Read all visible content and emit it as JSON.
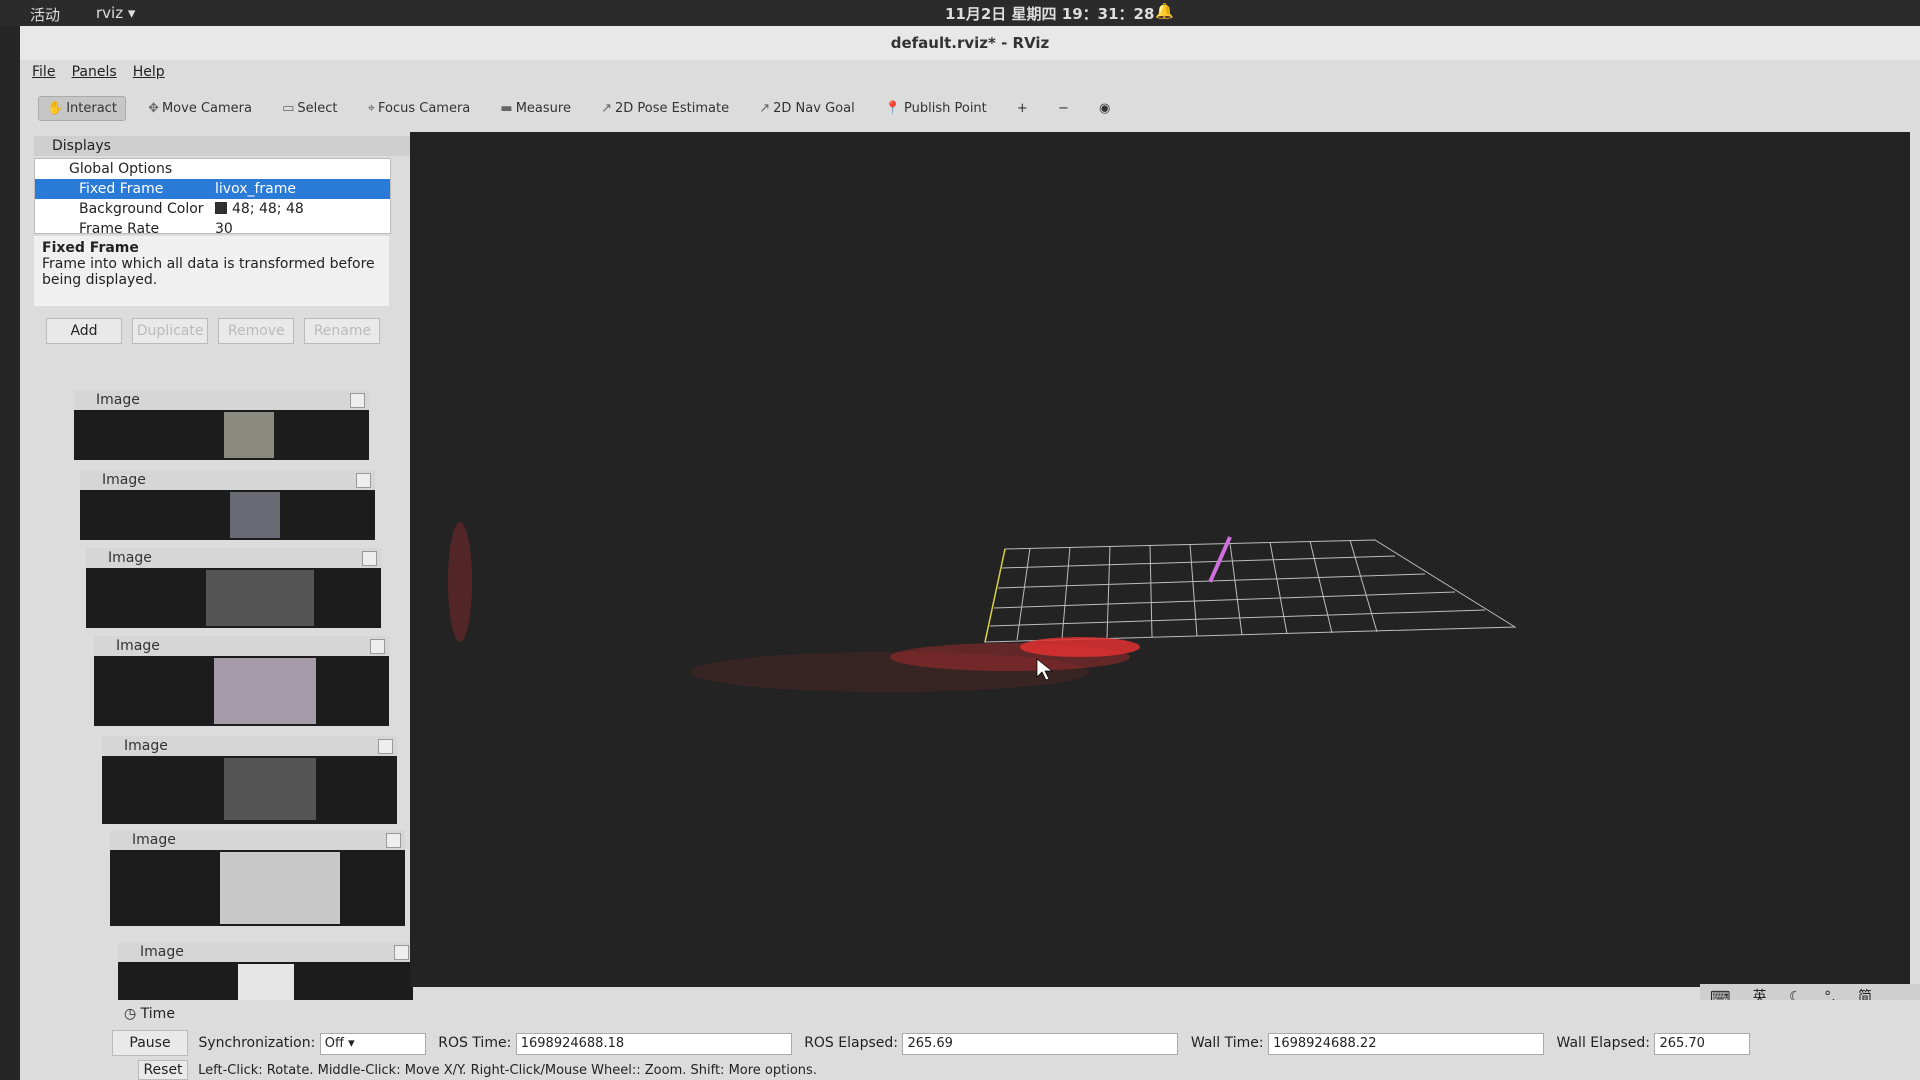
{
  "topbar": {
    "activities": "活动",
    "app": "rviz",
    "clock": "11月2日 星期四 19：31：28"
  },
  "window": {
    "title": "default.rviz* - RViz"
  },
  "menu": [
    "File",
    "Panels",
    "Help"
  ],
  "toolbar": [
    "Interact",
    "Move Camera",
    "Select",
    "Focus Camera",
    "Measure",
    "2D Pose Estimate",
    "2D Nav Goal",
    "Publish Point"
  ],
  "displays": {
    "title": "Displays",
    "rows": [
      {
        "key": "Global Options",
        "value": ""
      },
      {
        "key": "Fixed Frame",
        "value": "livox_frame"
      },
      {
        "key": "Background Color",
        "value": "48; 48; 48"
      },
      {
        "key": "Frame Rate",
        "value": "30"
      }
    ],
    "help_title": "Fixed Frame",
    "help_text": "Frame into which all data is transformed before being displayed.",
    "buttons": [
      "Add",
      "Duplicate",
      "Remove",
      "Rename"
    ]
  },
  "image_panels": [
    "Image",
    "Image",
    "Image",
    "Image",
    "Image",
    "Image",
    "Image"
  ],
  "time": {
    "title": "Time",
    "pause": "Pause",
    "sync_label": "Synchronization:",
    "sync_value": "Off",
    "ros_time_label": "ROS Time:",
    "ros_time": "1698924688.18",
    "ros_elapsed_label": "ROS Elapsed:",
    "ros_elapsed": "265.69",
    "wall_time_label": "Wall Time:",
    "wall_time": "1698924688.22",
    "wall_elapsed_label": "Wall Elapsed:",
    "wall_elapsed": "265.70"
  },
  "status": {
    "reset": "Reset",
    "text": "Left-Click: Rotate. Middle-Click: Move X/Y. Right-Click/Mouse Wheel:: Zoom. Shift: More options."
  },
  "ime": {
    "lang": "英",
    "mode": "简"
  }
}
